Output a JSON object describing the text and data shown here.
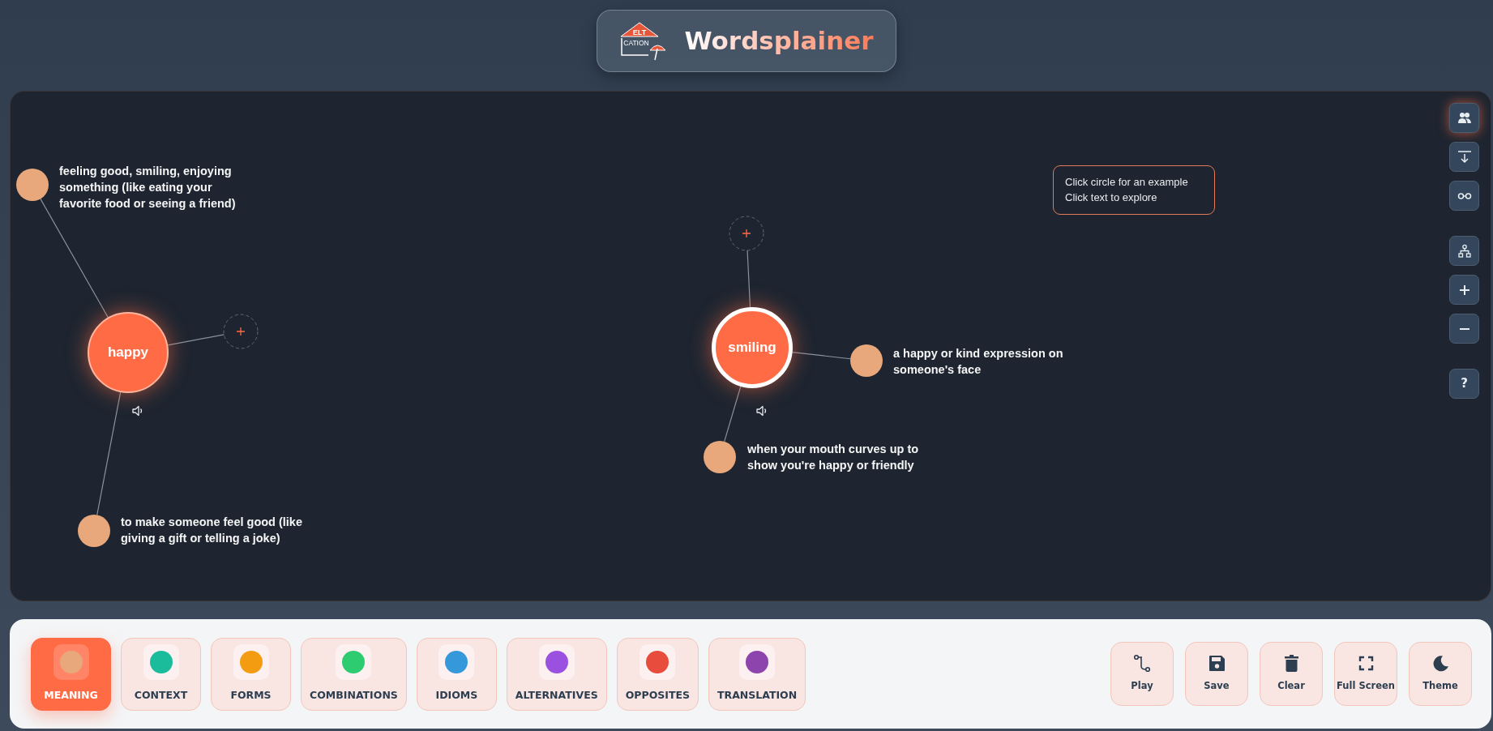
{
  "header": {
    "logo_lines": [
      "ELT",
      "CATION"
    ],
    "title": "Wordsplainer"
  },
  "tools": [
    {
      "kind": "people",
      "selected": true
    },
    {
      "kind": "arrow-down",
      "selected": false
    },
    {
      "kind": "glasses",
      "selected": false
    },
    {
      "kind": "hierarchy",
      "selected": false
    },
    {
      "kind": "plus",
      "selected": false
    },
    {
      "kind": "minus",
      "selected": false
    },
    {
      "kind": "help",
      "label": "?",
      "selected": false
    }
  ],
  "tooltip": {
    "lines": [
      "Click circle for an example",
      "Click text to explore"
    ]
  },
  "words": [
    {
      "word": "happy",
      "selected": false,
      "definitions": [
        "feeling good, smiling, enjoying something (like eating your favorite food or seeing a friend)",
        "to make someone feel good (like giving a gift or telling a joke)"
      ]
    },
    {
      "word": "smiling",
      "selected": true,
      "definitions": [
        "a happy or kind expression on someone's face",
        "when your mouth curves up to show you're happy or friendly"
      ]
    }
  ],
  "categories": [
    {
      "label": "MEANING",
      "color": "#e8a87c",
      "selected": true
    },
    {
      "label": "CONTEXT",
      "color": "#1abc9c",
      "selected": false
    },
    {
      "label": "FORMS",
      "color": "#f39c12",
      "selected": false
    },
    {
      "label": "COMBINATIONS",
      "color": "#2ecc71",
      "selected": false
    },
    {
      "label": "IDIOMS",
      "color": "#3498db",
      "selected": false
    },
    {
      "label": "ALTERNATIVES",
      "color": "#9b51e0",
      "selected": false
    },
    {
      "label": "OPPOSITES",
      "color": "#e74c3c",
      "selected": false
    },
    {
      "label": "TRANSLATION",
      "color": "#8e44ad",
      "selected": false
    }
  ],
  "actions": [
    {
      "kind": "play",
      "label": "Play"
    },
    {
      "kind": "save",
      "label": "Save"
    },
    {
      "kind": "clear",
      "label": "Clear"
    },
    {
      "kind": "fullscreen",
      "label": "Full Screen"
    },
    {
      "kind": "theme",
      "label": "Theme"
    }
  ]
}
